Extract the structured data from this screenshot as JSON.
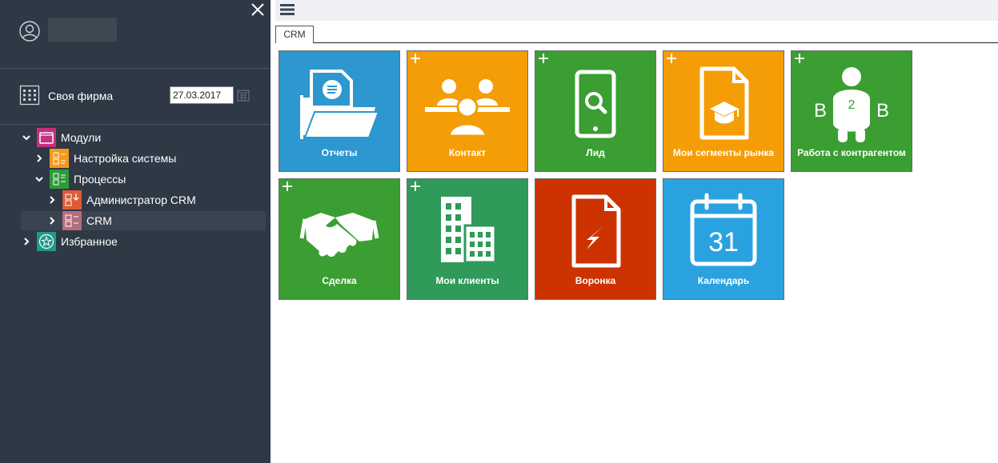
{
  "sidebar": {
    "user_name": "█████",
    "firm_label": "Своя фирма",
    "date_value": "27.03.2017",
    "tree": [
      {
        "label": "Модули",
        "icon": "modules-icon",
        "color": "#c2307f"
      },
      {
        "label": "Настройка системы",
        "icon": "system-settings-icon",
        "color": "#f39a1e"
      },
      {
        "label": "Процессы",
        "icon": "processes-icon",
        "color": "#2f9a3a"
      },
      {
        "label": "Администратор CRM",
        "icon": "crm-admin-icon",
        "color": "#e05a36"
      },
      {
        "label": "CRM",
        "icon": "crm-icon",
        "color": "#b36e7e"
      },
      {
        "label": "Избранное",
        "icon": "favorites-icon",
        "color": "#1e9a8a"
      }
    ]
  },
  "tabs": [
    {
      "label": "CRM"
    }
  ],
  "tiles": [
    {
      "label": "Отчеты",
      "color": "#2d97cf",
      "icon": "reports-folder-icon",
      "plus": false
    },
    {
      "label": "Контакт",
      "color": "#f59d06",
      "icon": "contact-people-icon",
      "plus": true
    },
    {
      "label": "Лид",
      "color": "#3a9e32",
      "icon": "lead-phone-search-icon",
      "plus": true
    },
    {
      "label": "Мои сегменты рынка",
      "color": "#f59d06",
      "icon": "market-segments-icon",
      "plus": true
    },
    {
      "label": "Работа с контрагентом",
      "color": "#3a9e32",
      "icon": "b2b-icon",
      "plus": true,
      "b2b": {
        "left": "B",
        "mid": "2",
        "right": "B"
      }
    },
    {
      "label": "Сделка",
      "color": "#3a9e32",
      "icon": "handshake-icon",
      "plus": true
    },
    {
      "label": "Мои клиенты",
      "color": "#2f9a5a",
      "icon": "buildings-icon",
      "plus": true
    },
    {
      "label": "Воронка",
      "color": "#cc3300",
      "icon": "funnel-document-icon",
      "plus": false
    },
    {
      "label": "Календарь",
      "color": "#2aa2e0",
      "icon": "calendar-icon",
      "plus": false,
      "calendar_day": "31"
    }
  ]
}
